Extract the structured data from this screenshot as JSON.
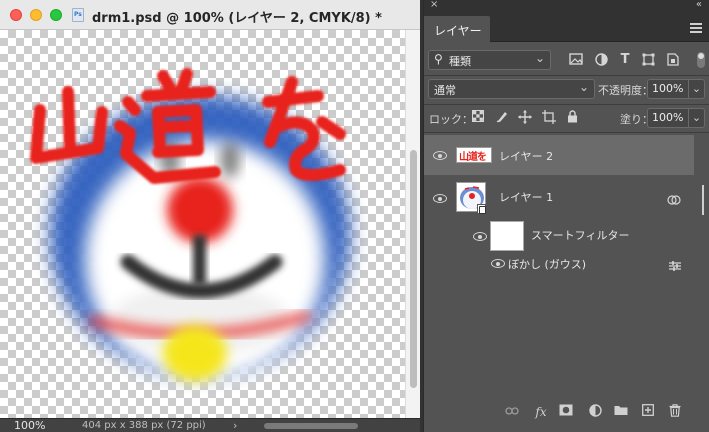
{
  "document": {
    "title": "drm1.psd @ 100% (レイヤー 2, CMYK/8) *",
    "zoom": "100%",
    "doc_info": "404 px x 388 px (72 ppi)",
    "status_arrow": "›",
    "canvas_text": "山道を"
  },
  "layers_panel": {
    "tab_label": "レイヤー",
    "close_label": "×",
    "collapse_label": "«",
    "filter": {
      "label": "種類",
      "search_icon": "search-icon"
    },
    "blend_mode": "通常",
    "opacity_label": "不透明度：",
    "opacity_value": "100%",
    "lock_label": "ロック：",
    "fill_label": "塗り：",
    "fill_value": "100%",
    "layers": [
      {
        "name": "レイヤー 2",
        "selected": true,
        "thumbnail_text": "山道を"
      },
      {
        "name": "レイヤー 1",
        "selected": false
      },
      {
        "name": "スマートフィルター",
        "is_filter_group": true
      },
      {
        "name": "ぼかし (ガウス)",
        "is_filter": true
      }
    ],
    "bottom_icons": [
      "link-icon",
      "fx-icon",
      "mask-icon",
      "adjustment-icon",
      "folder-icon",
      "new-layer-icon",
      "trash-icon"
    ],
    "fx_label": "fx"
  },
  "colors": {
    "panel_bg": "#535353",
    "selected_row": "#6b6b6b",
    "canvas_red": "#e8211b",
    "canvas_blue": "#2f5fbf",
    "canvas_yellow": "#f5e61a"
  }
}
